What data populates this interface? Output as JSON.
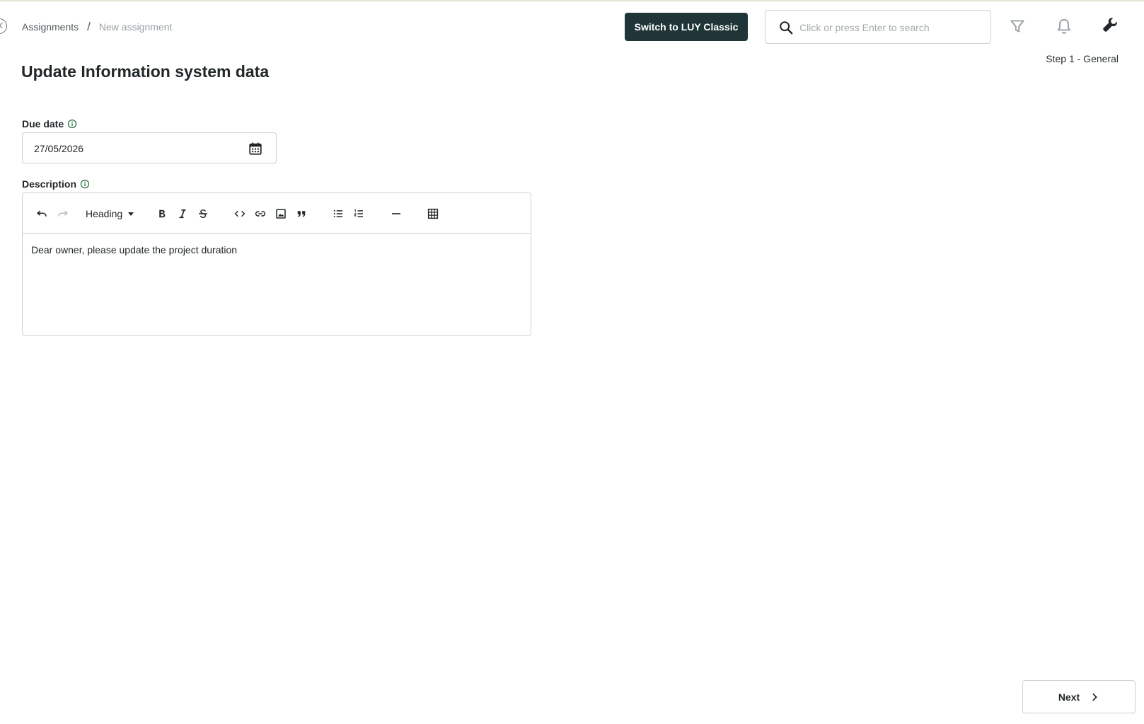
{
  "header": {
    "breadcrumb": {
      "root": "Assignments",
      "separator": "/",
      "current": "New assignment"
    },
    "switch_button": "Switch to LUY Classic",
    "search": {
      "placeholder": "Click or press Enter to search",
      "value": ""
    },
    "icons": [
      "back-icon",
      "search-icon",
      "filter-icon",
      "bell-icon",
      "wrench-icon"
    ]
  },
  "step_label": "Step 1 - General",
  "page_title": "Update Information system data",
  "form": {
    "due_date": {
      "label": "Due date",
      "value": "27/05/2026",
      "icon": "calendar-icon"
    },
    "description": {
      "label": "Description",
      "toolbar": {
        "heading_label": "Heading",
        "tools": [
          "undo",
          "redo",
          "heading",
          "bold",
          "italic",
          "strikethrough",
          "code",
          "link",
          "image",
          "blockquote",
          "bullet-list",
          "numbered-list",
          "horizontal-rule",
          "table"
        ]
      },
      "content": "Dear owner, please update the project duration"
    }
  },
  "footer": {
    "next_button": "Next"
  },
  "colors": {
    "primary_dark": "#1f3538",
    "border": "#cdd1d3",
    "muted_text": "#9aa0a4",
    "info_green": "#1e6b3a"
  }
}
